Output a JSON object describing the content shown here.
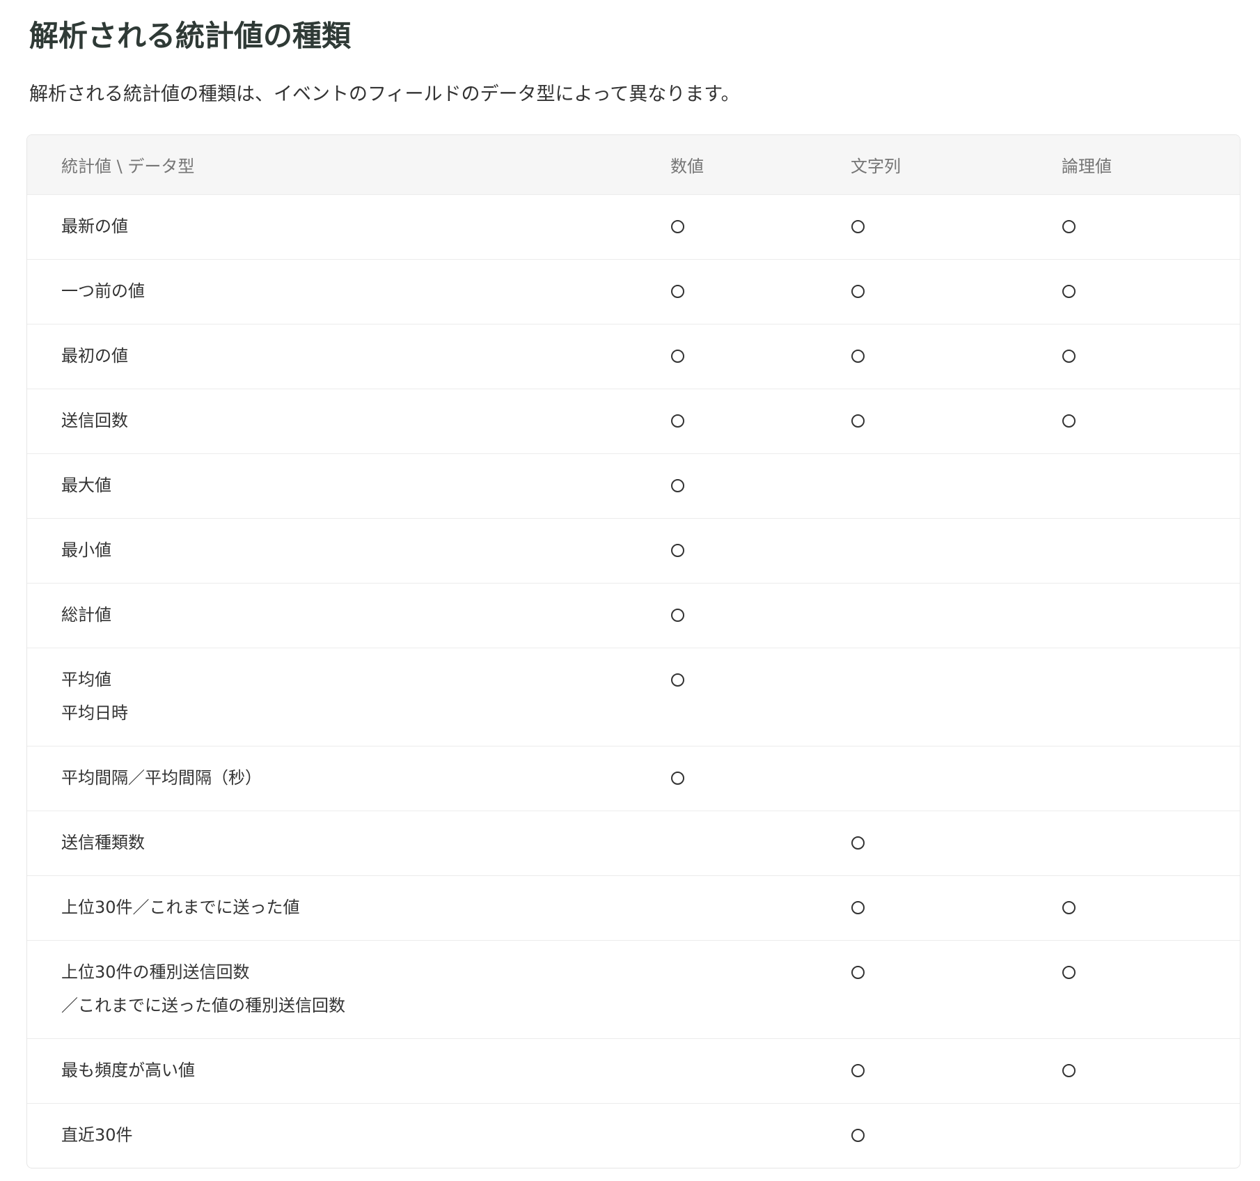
{
  "title": "解析される統計値の種類",
  "description": "解析される統計値の種類は、イベントのフィールドのデータ型によって異なります。",
  "table": {
    "headers": [
      "統計値 \\ データ型",
      "数値",
      "文字列",
      "論理値"
    ],
    "mark_symbol": "○",
    "rows": [
      {
        "label": [
          "最新の値"
        ],
        "number": true,
        "string": true,
        "boolean": true
      },
      {
        "label": [
          "一つ前の値"
        ],
        "number": true,
        "string": true,
        "boolean": true
      },
      {
        "label": [
          "最初の値"
        ],
        "number": true,
        "string": true,
        "boolean": true
      },
      {
        "label": [
          "送信回数"
        ],
        "number": true,
        "string": true,
        "boolean": true
      },
      {
        "label": [
          "最大値"
        ],
        "number": true,
        "string": false,
        "boolean": false
      },
      {
        "label": [
          "最小値"
        ],
        "number": true,
        "string": false,
        "boolean": false
      },
      {
        "label": [
          "総計値"
        ],
        "number": true,
        "string": false,
        "boolean": false
      },
      {
        "label": [
          "平均値",
          "平均日時"
        ],
        "number": true,
        "string": false,
        "boolean": false
      },
      {
        "label": [
          "平均間隔／平均間隔（秒）"
        ],
        "number": true,
        "string": false,
        "boolean": false
      },
      {
        "label": [
          "送信種類数"
        ],
        "number": false,
        "string": true,
        "boolean": false
      },
      {
        "label": [
          "上位30件／これまでに送った値"
        ],
        "number": false,
        "string": true,
        "boolean": true
      },
      {
        "label": [
          "上位30件の種別送信回数",
          "／これまでに送った値の種別送信回数"
        ],
        "number": false,
        "string": true,
        "boolean": true
      },
      {
        "label": [
          "最も頻度が高い値"
        ],
        "number": false,
        "string": true,
        "boolean": true
      },
      {
        "label": [
          "直近30件"
        ],
        "number": false,
        "string": true,
        "boolean": false
      }
    ]
  }
}
